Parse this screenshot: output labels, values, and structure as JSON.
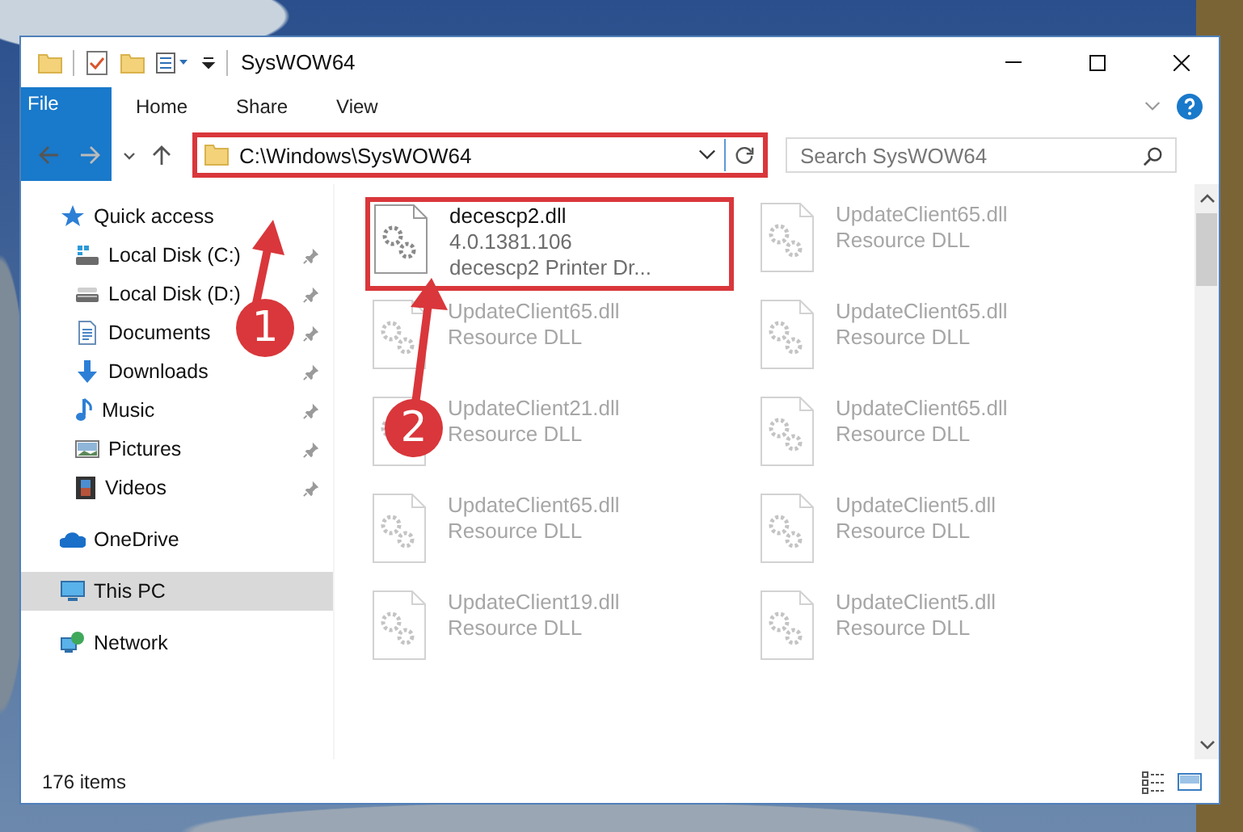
{
  "window": {
    "title": "SysWOW64"
  },
  "ribbon_tabs": [
    {
      "label": "File",
      "kind": "file"
    },
    {
      "label": "Home",
      "kind": "tab"
    },
    {
      "label": "Share",
      "kind": "tab"
    },
    {
      "label": "View",
      "kind": "tab"
    }
  ],
  "address_bar": {
    "value": "C:\\Windows\\SysWOW64",
    "highlighted": true
  },
  "search": {
    "placeholder": "Search SysWOW64"
  },
  "nav": [
    {
      "label": "Quick access",
      "kind": "star",
      "pinned": false,
      "selected": false,
      "children": [
        {
          "label": "Local Disk (C:)",
          "kind": "disk-c",
          "pinned": true,
          "selected": false
        },
        {
          "label": "Local Disk (D:)",
          "kind": "disk",
          "pinned": true,
          "selected": false
        },
        {
          "label": "Documents",
          "kind": "documents",
          "pinned": true,
          "selected": false
        },
        {
          "label": "Downloads",
          "kind": "downloads",
          "pinned": true,
          "selected": false
        },
        {
          "label": "Music",
          "kind": "music",
          "pinned": true,
          "selected": false
        },
        {
          "label": "Pictures",
          "kind": "pictures",
          "pinned": true,
          "selected": false
        },
        {
          "label": "Videos",
          "kind": "videos",
          "pinned": true,
          "selected": false
        }
      ]
    },
    {
      "label": "OneDrive",
      "kind": "cloud",
      "pinned": false,
      "selected": false
    },
    {
      "label": "This PC",
      "kind": "pc",
      "pinned": false,
      "selected": true
    },
    {
      "label": "Network",
      "kind": "network",
      "pinned": false,
      "selected": false
    }
  ],
  "files": [
    {
      "name": "decescp2.dll",
      "details": [
        "4.0.1381.106",
        "decescp2 Printer Dr..."
      ],
      "faded": false,
      "highlighted": true
    },
    {
      "name": "UpdateClient65.dll",
      "details": [
        "Resource DLL"
      ],
      "faded": true,
      "highlighted": false
    },
    {
      "name": "UpdateClient65.dll",
      "details": [
        "Resource DLL"
      ],
      "faded": true,
      "highlighted": false
    },
    {
      "name": "UpdateClient65.dll",
      "details": [
        "Resource DLL"
      ],
      "faded": true,
      "highlighted": false
    },
    {
      "name": "UpdateClient21.dll",
      "details": [
        "Resource DLL"
      ],
      "faded": true,
      "highlighted": false
    },
    {
      "name": "UpdateClient65.dll",
      "details": [
        "Resource DLL"
      ],
      "faded": true,
      "highlighted": false
    },
    {
      "name": "UpdateClient65.dll",
      "details": [
        "Resource DLL"
      ],
      "faded": true,
      "highlighted": false
    },
    {
      "name": "UpdateClient5.dll",
      "details": [
        "Resource DLL"
      ],
      "faded": true,
      "highlighted": false
    },
    {
      "name": "UpdateClient19.dll",
      "details": [
        "Resource DLL"
      ],
      "faded": true,
      "highlighted": false
    },
    {
      "name": "UpdateClient5.dll",
      "details": [
        "Resource DLL"
      ],
      "faded": true,
      "highlighted": false
    }
  ],
  "callouts": [
    {
      "number": "1"
    },
    {
      "number": "2"
    }
  ],
  "status_bar": {
    "item_count": "176 items"
  }
}
